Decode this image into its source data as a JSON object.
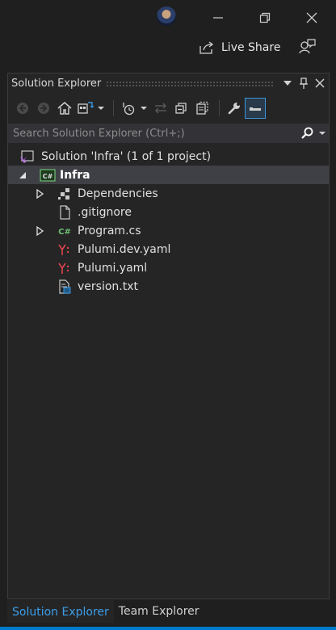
{
  "titlebar": {
    "minimize_icon": "minimize-icon",
    "restore_icon": "restore-icon",
    "close_icon": "close-icon",
    "live_share_label": "Live Share"
  },
  "panel": {
    "title": "Solution Explorer",
    "search_placeholder": "Search Solution Explorer (Ctrl+;)"
  },
  "tree": {
    "solution": "Solution 'Infra' (1 of 1 project)",
    "project": "Infra",
    "items": [
      {
        "label": "Dependencies",
        "icon": "dependencies-icon"
      },
      {
        "label": ".gitignore",
        "icon": "file-icon"
      },
      {
        "label": "Program.cs",
        "icon": "csharp-file-icon"
      },
      {
        "label": "Pulumi.dev.yaml",
        "icon": "yaml-file-icon"
      },
      {
        "label": "Pulumi.yaml",
        "icon": "yaml-file-icon"
      },
      {
        "label": "version.txt",
        "icon": "text-file-icon"
      }
    ]
  },
  "tabs": [
    {
      "label": "Solution Explorer",
      "active": true
    },
    {
      "label": "Team Explorer",
      "active": false
    }
  ],
  "colors": {
    "accent": "#007acc",
    "active_tab_text": "#3c9ee8",
    "csharp": "#6fbf73",
    "yaml": "#e0444c",
    "vs_purple": "#9b59d0"
  }
}
